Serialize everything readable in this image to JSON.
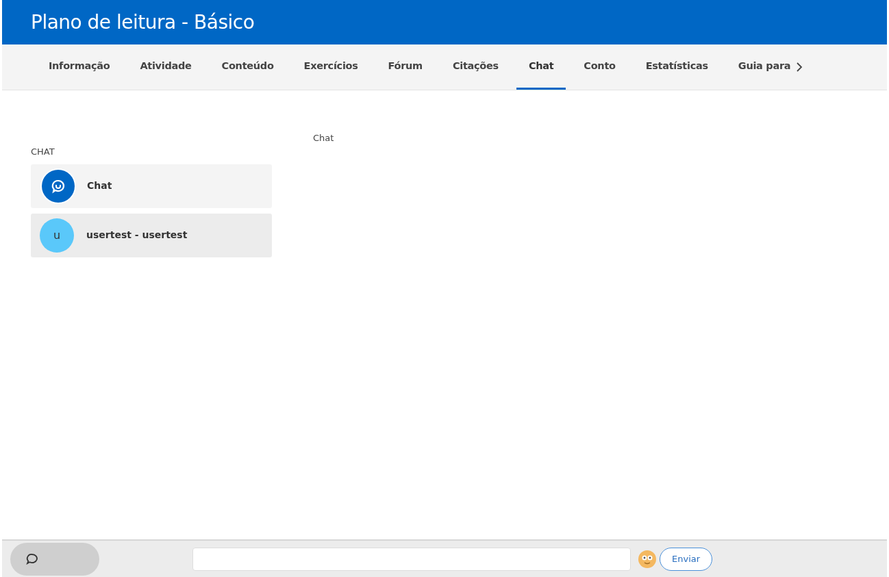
{
  "header": {
    "title": "Plano de leitura - Básico"
  },
  "tabs": [
    {
      "label": "Informação",
      "selected": false
    },
    {
      "label": "Atividade",
      "selected": false
    },
    {
      "label": "Conteúdo",
      "selected": false
    },
    {
      "label": "Exercícios",
      "selected": false
    },
    {
      "label": "Fórum",
      "selected": false
    },
    {
      "label": "Citações",
      "selected": false
    },
    {
      "label": "Chat",
      "selected": true
    },
    {
      "label": "Conto",
      "selected": false
    },
    {
      "label": "Estatísticas",
      "selected": false
    },
    {
      "label": "Guia para",
      "selected": false
    }
  ],
  "sidebar": {
    "heading": "CHAT",
    "items": [
      {
        "kind": "group",
        "name": "Chat"
      },
      {
        "kind": "user",
        "initial": "u",
        "name": "usertest - usertest"
      }
    ]
  },
  "panel": {
    "title": "Chat"
  },
  "composer": {
    "send_label": "Enviar"
  }
}
